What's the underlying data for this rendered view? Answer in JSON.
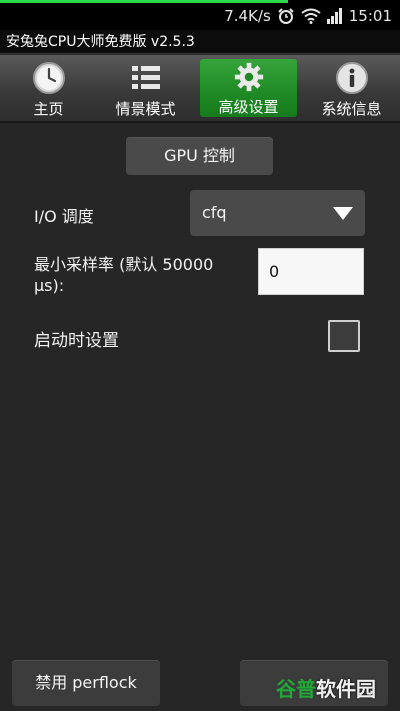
{
  "status_bar": {
    "network_speed": "7.4K/s",
    "time": "15:01",
    "icons": [
      "alarm-clock-icon",
      "wifi-icon",
      "signal-icon"
    ],
    "accent_color": "#2bd94a"
  },
  "app": {
    "title": "安兔兔CPU大师免费版 v2.5.3"
  },
  "tabs": [
    {
      "label": "主页",
      "icon": "clock-icon",
      "active": false
    },
    {
      "label": "情景模式",
      "icon": "list-icon",
      "active": false
    },
    {
      "label": "高级设置",
      "icon": "gear-icon",
      "active": true
    },
    {
      "label": "系统信息",
      "icon": "info-icon",
      "active": false
    }
  ],
  "content": {
    "gpu_button": "GPU 控制",
    "io": {
      "label": "I/O 调度",
      "value": "cfq"
    },
    "sampling_rate": {
      "label": "最小采样率 (默认 50000 μs):",
      "value": "0"
    },
    "startup": {
      "label": "启动时设置",
      "checked": false
    }
  },
  "bottom": {
    "disable_button": "禁用 perflock"
  },
  "watermark": {
    "part1": "谷普",
    "part2": "软件园"
  },
  "colors": {
    "active_tab": "#1f8a25",
    "background": "#262626"
  }
}
